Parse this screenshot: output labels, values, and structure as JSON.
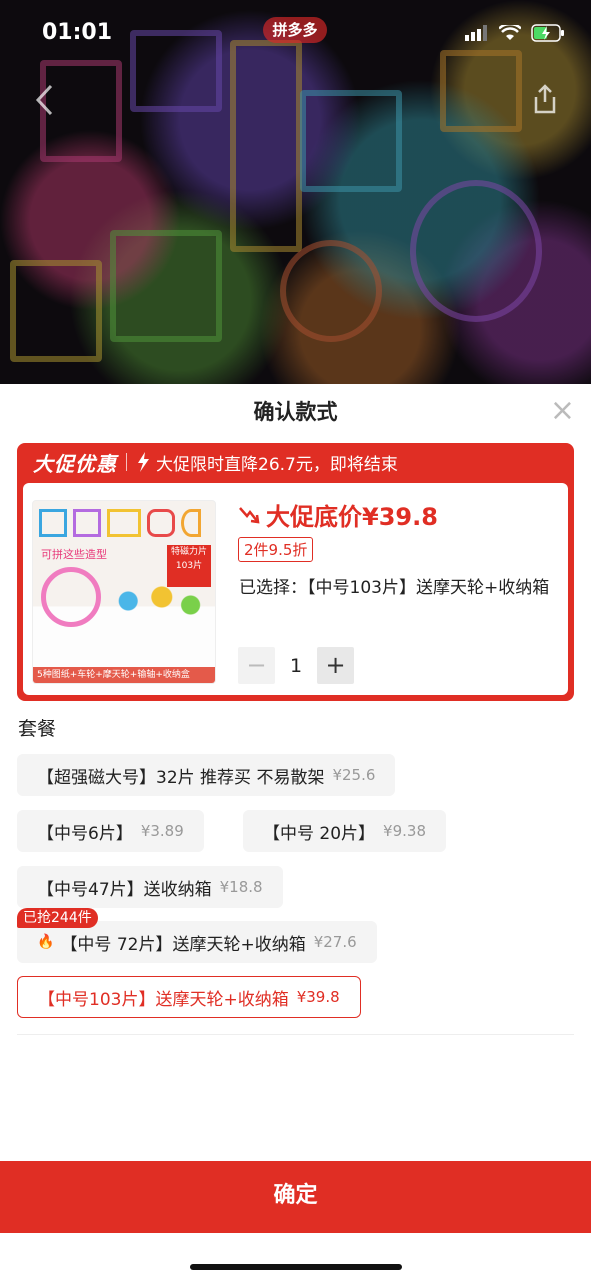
{
  "status_bar": {
    "time": "01:01"
  },
  "top": {
    "app_badge": "拼多多"
  },
  "sheet": {
    "title": "确认款式",
    "close": "×"
  },
  "promo": {
    "tag": "大促优惠",
    "text": "大促限时直降26.7元，即将结束",
    "price_label": "大促底价¥39.8",
    "discount": "2件9.5折",
    "selected": "已选择：【中号103片】送摩天轮+收纳箱",
    "quantity": "1",
    "minus": "−",
    "plus": "+"
  },
  "thumbnail": {
    "caption": "可拼这些造型",
    "badge": "特磁力片 103片",
    "strip": "5种图纸+车轮+摩天轮+输轴+收纳盒"
  },
  "section_title": "套餐",
  "options": [
    {
      "name": "【超强磁大号】32片 推荐买 不易散架",
      "price": "¥25.6"
    },
    {
      "name": "【中号6片】",
      "price": "¥3.89"
    },
    {
      "name": "【中号 20片】",
      "price": "¥9.38"
    },
    {
      "name": "【中号47片】送收纳箱",
      "price": "¥18.8"
    },
    {
      "name": "【中号 72片】送摩天轮+收纳箱",
      "price": "¥27.6"
    },
    {
      "name": "【中号103片】送摩天轮+收纳箱",
      "price": "¥39.8"
    }
  ],
  "hot_badge": "已抢244件",
  "confirm_button": "确定",
  "colors": {
    "accent": "#e02e24"
  }
}
